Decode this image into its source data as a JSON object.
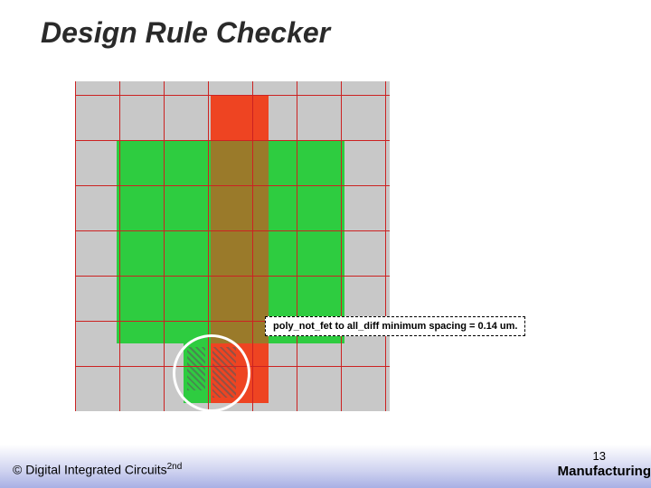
{
  "title": "Design Rule Checker",
  "error_message": "poly_not_fet to all_diff minimum spacing = 0.14 um.",
  "footer": {
    "copyright_pre": "© Digital Integrated Circuits",
    "copyright_sup": "2nd",
    "slide_number": "13",
    "section": "Manufacturing"
  },
  "grid": {
    "rows": 7,
    "cols": 7
  }
}
